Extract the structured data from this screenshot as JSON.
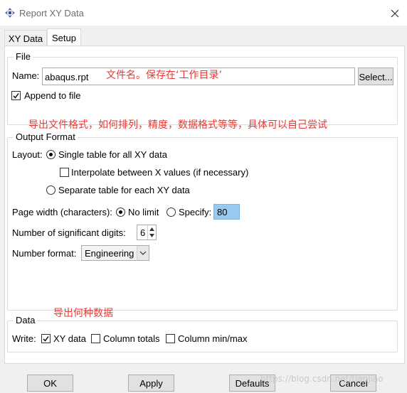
{
  "window": {
    "title": "Report XY Data",
    "app_icon": "abaqus-icon",
    "close_icon": "close-icon"
  },
  "tabs": [
    {
      "label": "XY Data",
      "active": false
    },
    {
      "label": "Setup",
      "active": true
    }
  ],
  "file": {
    "legend": "File",
    "name_label": "Name:",
    "name_value": "abaqus.rpt",
    "select_label": "Select...",
    "append_label": "Append to file",
    "append_checked": true
  },
  "output_format": {
    "legend": "Output Format",
    "layout_label": "Layout:",
    "single_table_label": "Single table for all XY data",
    "single_table_selected": true,
    "interpolate_label": "Interpolate between X values (if necessary)",
    "interpolate_checked": false,
    "separate_table_label": "Separate table for each XY data",
    "page_width_label": "Page width (characters):",
    "no_limit_label": "No limit",
    "no_limit_selected": true,
    "specify_label": "Specify:",
    "specify_value": "80",
    "sig_digits_label": "Number of significant digits:",
    "sig_digits_value": "6",
    "number_format_label": "Number format:",
    "number_format_value": "Engineering"
  },
  "data": {
    "legend": "Data",
    "write_label": "Write:",
    "xy_data_label": "XY data",
    "xy_data_checked": true,
    "column_totals_label": "Column totals",
    "column_totals_checked": false,
    "column_minmax_label": "Column min/max",
    "column_minmax_checked": false
  },
  "buttons": {
    "ok": "OK",
    "apply": "Apply",
    "defaults": "Defaults",
    "cancel": "Cancel"
  },
  "annotations": {
    "file_note": "文件名。保存在‘工作目录’",
    "format_note": "导出文件格式，如何排列，精度，数据格式等等，具体可以自己尝试",
    "data_note": "导出何种数据"
  },
  "watermark": "https://blog.csdn.net/tianjiao",
  "colors": {
    "annotation": "#e53935",
    "selection": "#99c9ef"
  }
}
